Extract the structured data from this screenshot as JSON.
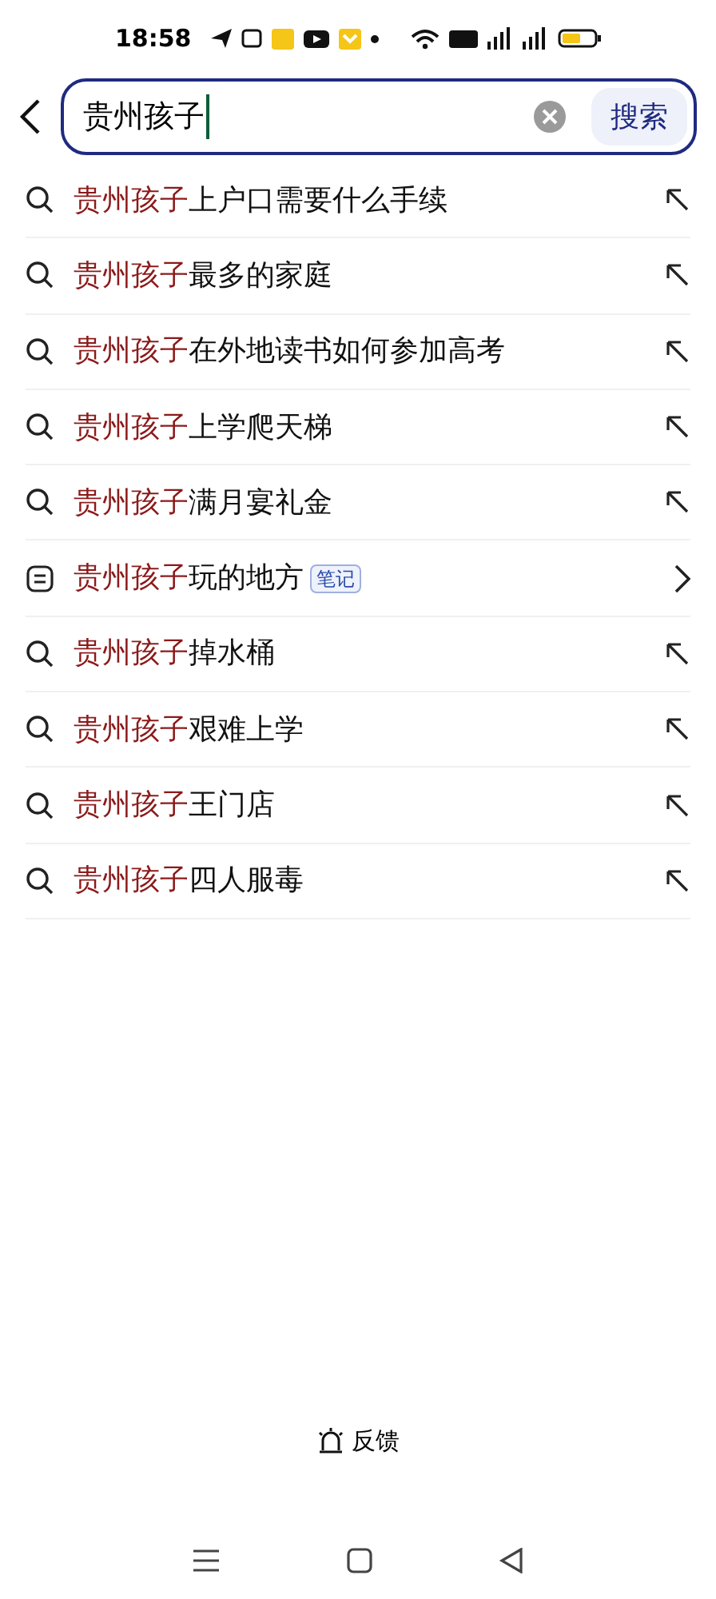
{
  "status_bar": {
    "time": "18:58"
  },
  "search": {
    "value": "贵州孩子",
    "button": "搜索"
  },
  "suggestions": [
    {
      "kind": "search",
      "highlight": "贵州孩子",
      "rest": "上户口需要什么手续"
    },
    {
      "kind": "search",
      "highlight": "贵州孩子",
      "rest": "最多的家庭"
    },
    {
      "kind": "search",
      "highlight": "贵州孩子",
      "rest": "在外地读书如何参加高考"
    },
    {
      "kind": "search",
      "highlight": "贵州孩子",
      "rest": "上学爬天梯"
    },
    {
      "kind": "search",
      "highlight": "贵州孩子",
      "rest": "满月宴礼金"
    },
    {
      "kind": "note",
      "highlight": "贵州孩子",
      "rest": "玩的地方",
      "tag": "笔记"
    },
    {
      "kind": "search",
      "highlight": "贵州孩子",
      "rest": "掉水桶"
    },
    {
      "kind": "search",
      "highlight": "贵州孩子",
      "rest": "艰难上学"
    },
    {
      "kind": "search",
      "highlight": "贵州孩子",
      "rest": "王门店"
    },
    {
      "kind": "search",
      "highlight": "贵州孩子",
      "rest": "四人服毒"
    }
  ],
  "feedback": "反馈"
}
